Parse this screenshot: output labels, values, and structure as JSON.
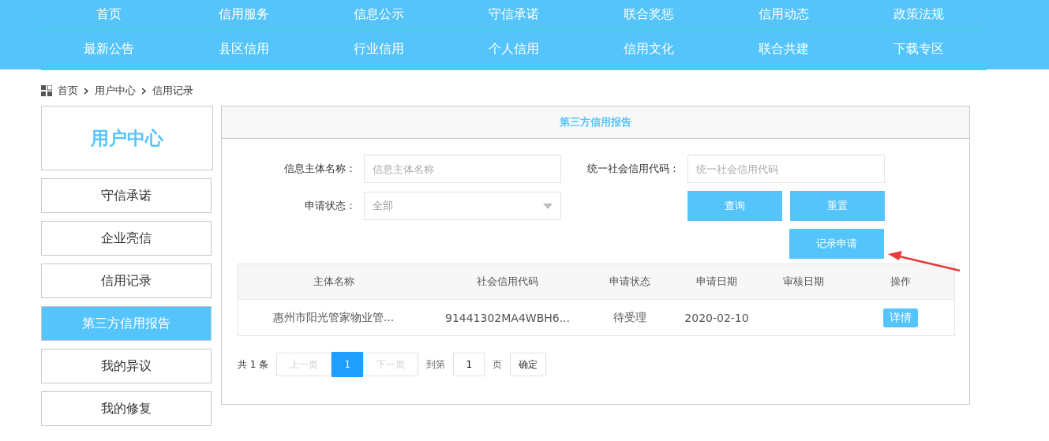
{
  "nav_rows": [
    [
      "首页",
      "信用服务",
      "信息公示",
      "守信承诺",
      "联合奖惩",
      "信用动态",
      "政策法规"
    ],
    [
      "最新公告",
      "县区信用",
      "行业信用",
      "个人信用",
      "信用文化",
      "联合共建",
      "下载专区"
    ]
  ],
  "breadcrumb": [
    "首页",
    "用户中心",
    "信用记录"
  ],
  "sidebar": {
    "title": "用户中心",
    "items": [
      {
        "label": "守信承诺",
        "selected": false
      },
      {
        "label": "企业亮信",
        "selected": false
      },
      {
        "label": "信用记录",
        "selected": false
      },
      {
        "label": "第三方信用报告",
        "selected": true
      },
      {
        "label": "我的异议",
        "selected": false
      },
      {
        "label": "我的修复",
        "selected": false
      }
    ]
  },
  "panel": {
    "title": "第三方信用报告",
    "form": {
      "name_label": "信息主体名称：",
      "name_placeholder": "信息主体名称",
      "code_label": "统一社会信用代码：",
      "code_placeholder": "统一社会信用代码",
      "status_label": "申请状态：",
      "status_value": "全部"
    },
    "buttons": [
      "查询",
      "重置",
      "记录申请"
    ],
    "table": {
      "columns": [
        "主体名称",
        "社会信用代码",
        "申请状态",
        "申请日期",
        "审核日期",
        "操作"
      ],
      "rows": [
        {
          "cells": [
            "惠州市阳光管家物业管...",
            "91441302MA4WBH6...",
            "待受理",
            "2020-02-10",
            ""
          ],
          "action": "详情"
        }
      ]
    },
    "pagination": {
      "total": "共 1 条",
      "prev": "上一页",
      "pages": [
        {
          "label": "1",
          "selected": true
        }
      ],
      "next": "下一页",
      "goto": "到第",
      "page_value": "1",
      "page_unit": "页",
      "confirm": "确定"
    }
  }
}
